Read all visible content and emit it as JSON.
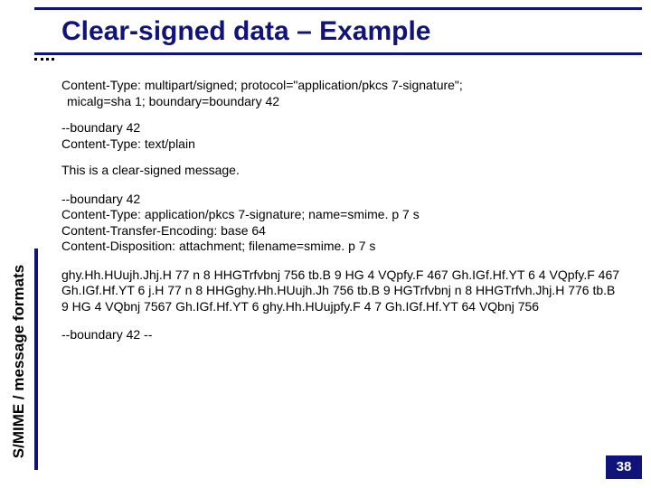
{
  "title": "Clear-signed data – Example",
  "side_label": "S/MIME / message formats",
  "body": {
    "ct_line1": "Content-Type: multipart/signed; protocol=\"application/pkcs 7-signature\";",
    "ct_line2": "micalg=sha 1; boundary=boundary 42",
    "b1_open": "--boundary 42",
    "b1_ct": "Content-Type: text/plain",
    "msg": "This is a clear-signed message.",
    "b2_open": "--boundary 42",
    "b2_ct": "Content-Type: application/pkcs 7-signature; name=smime. p 7 s",
    "b2_cte": "Content-Transfer-Encoding: base 64",
    "b2_cd": "Content-Disposition: attachment; filename=smime. p 7 s",
    "b64": "ghy.Hh.HUujh.Jhj.H 77 n 8 HHGTrfvbnj 756 tb.B 9 HG 4 VQpfy.F 467 Gh.IGf.Hf.YT 6 4 VQpfy.F 467 Gh.IGf.Hf.YT 6 j.H 77 n 8 HHGghy.Hh.HUujh.Jh 756 tb.B 9 HGTrfvbnj n 8 HHGTrfvh.Jhj.H 776 tb.B 9 HG 4 VQbnj 7567 Gh.IGf.Hf.YT 6 ghy.Hh.HUujpfy.F 4 7 Gh.IGf.Hf.YT 64 VQbnj 756",
    "b_close": "--boundary 42 --"
  },
  "page_number": "38"
}
